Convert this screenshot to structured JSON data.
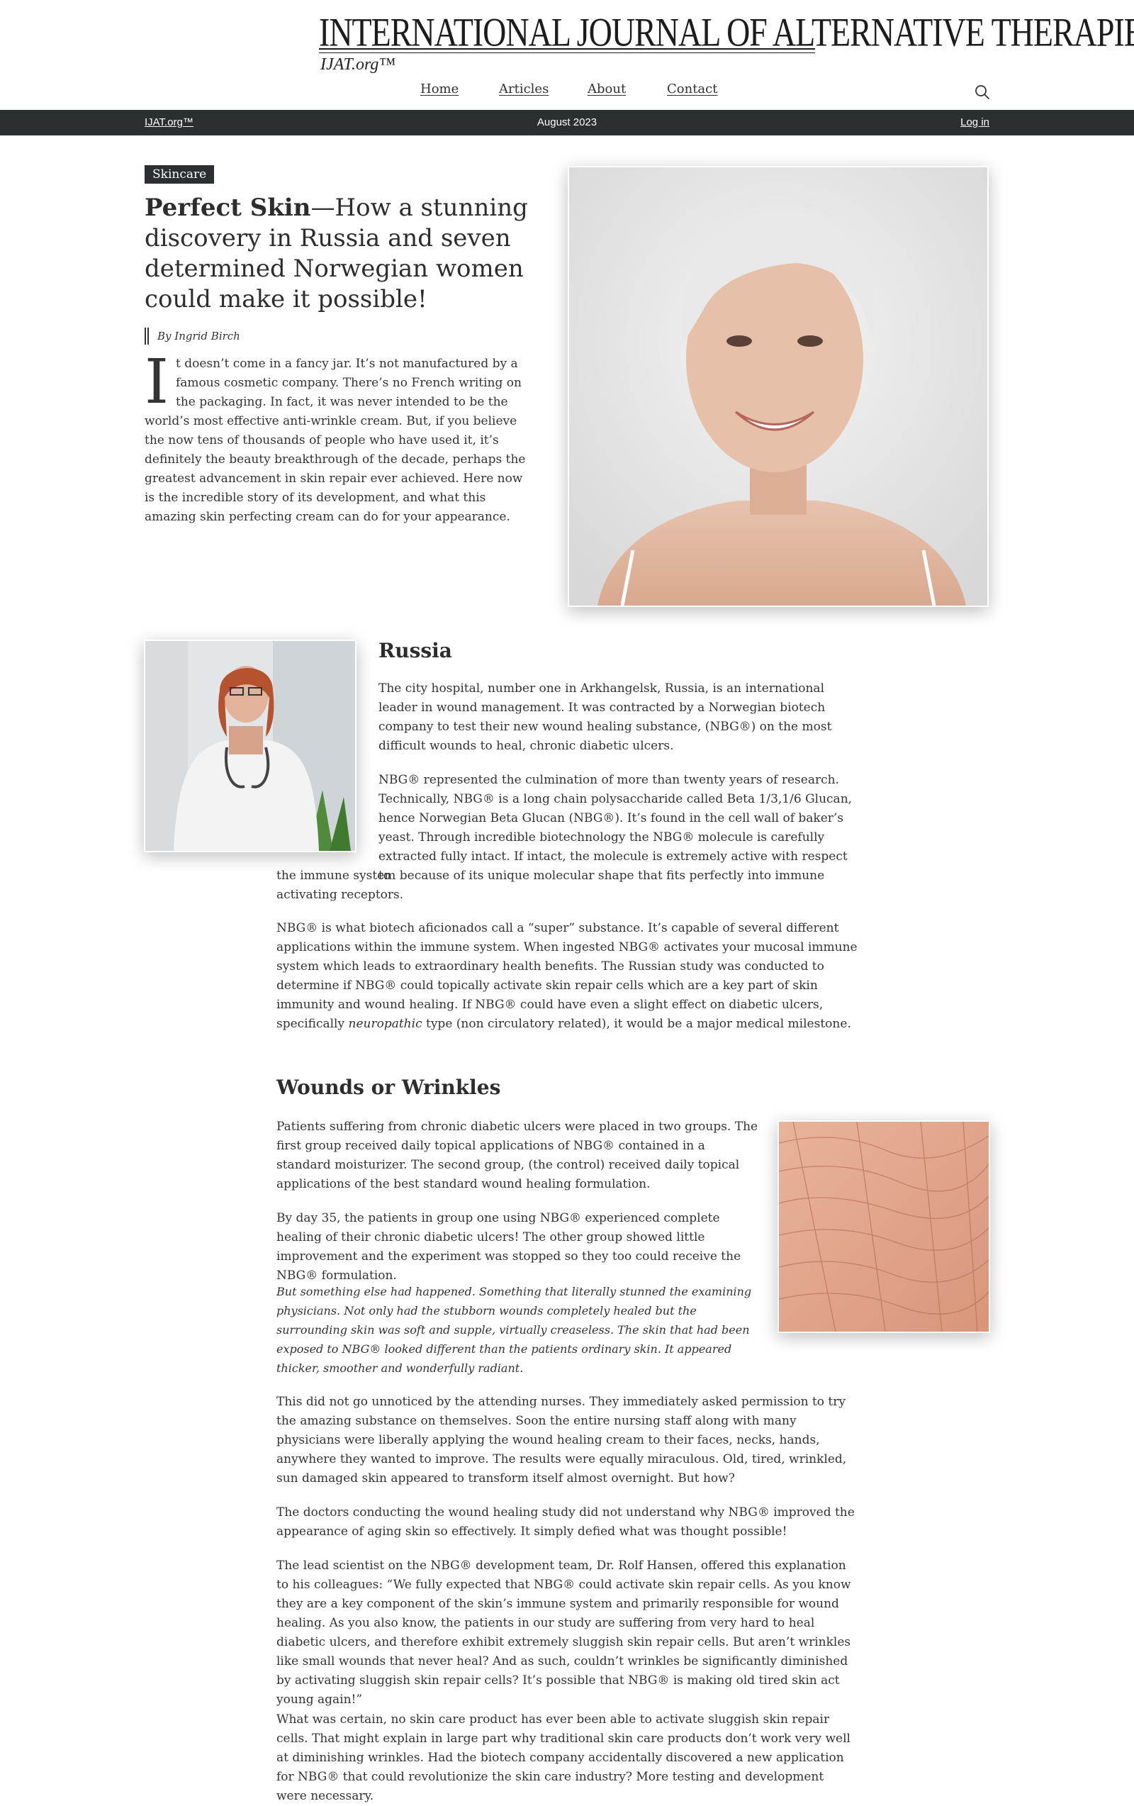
{
  "site": {
    "title": "International Journal of Alternative Therapies",
    "subtitle": "IJAT.org™"
  },
  "nav": {
    "items": [
      "Home",
      "Articles",
      "About",
      "Contact"
    ],
    "search_icon": "search-icon"
  },
  "topbar": {
    "left": "IJAT.org™",
    "date": "August 2023",
    "login": "Log in",
    "bg_color": "#2b2f30"
  },
  "article": {
    "category": "Skincare",
    "headline_bold": "Perfect Skin",
    "headline_rest": "—How a stunning discovery in Russia and seven determined Norwegian women could make it possible!",
    "byline": "By Ingrid Birch",
    "intro_dropcap": "I",
    "intro": "t doesn’t come in a fancy jar. It’s not manufactured by a famous cosmetic company. There’s no French writing on the packaging. In fact, it was never intended to be the world’s most effective anti-wrinkle cream. But, if you believe the now tens of thousands of people who have used it, it’s definitely the beauty breakthrough of the decade, perhaps the greatest advancement in skin repair ever achieved. Here now is the incredible story of its development, and what this amazing skin perfecting cream can do for your appearance."
  },
  "russia": {
    "heading": "Russia",
    "p1": "The city hospital, number one in Arkhangelsk, Russia, is an international leader in wound management. It was contracted by a Norwegian biotech company to test their new wound healing substance, (NBG®) on the most difficult wounds to heal, chronic diabetic ulcers.",
    "p2a": "NBG® represented the culmination of more than twenty years of research. Technically, NBG® is a long chain polysaccharide called Beta 1/3,1/6 Glucan, hence Norwegian Beta Glucan (NBG®). It’s found in the cell wall of baker’s yeast. Through incredible biotechnology the NBG® molecule is carefully extracted fully intact. If intact, the molecule is extremely active with respect to",
    "p2b": "the immune system because of its unique molecular shape that fits perfectly into immune activating receptors.",
    "p3": "NBG® is what biotech aficionados call a “super” substance. It’s capable of several different applications within the immune system. When ingested NBG® activates your mucosal immune system which leads to extraordinary health benefits. The Russian study was conducted to determine if NBG® could topically activate skin repair cells which are a key part of skin immunity and wound healing. If NBG® could have even a slight effect on diabetic ulcers, specifically",
    "p3_italic": "neuropathic",
    "p3_end": " type (non circulatory related), it would be a major medical milestone."
  },
  "wounds": {
    "heading": "Wounds or Wrinkles",
    "p1": "Patients suffering from chronic diabetic ulcers were placed in two groups. The first group received daily topical applications of NBG® contained in a standard moisturizer. The second group, (the control) received daily topical applications of the best standard wound healing formulation.",
    "p2": "By day 35, the patients in group one using NBG® experienced complete healing of their chronic diabetic ulcers! The other group showed little improvement and the experiment was stopped so they too could receive the NBG® formulation.",
    "p3": "But something else had happened. Something that literally stunned the examining physicians. Not only had the stubborn wounds completely healed but the surrounding skin was soft and supple, virtually creaseless. The skin that had been exposed to NBG® looked different than the patients ordinary skin. It appeared thicker, smoother and wonderfully radiant.",
    "p4": "This did not go unnoticed by the attending nurses. They immediately asked permission to try the amazing substance on themselves. Soon the entire nursing staff along with many physicians were liberally applying the wound healing cream to their faces, necks, hands, anywhere they wanted to improve. The results were equally miraculous. Old, tired, wrinkled, sun damaged skin appeared to transform itself almost overnight. But how?",
    "p5": "The doctors conducting the wound healing study did not understand why NBG® improved the appearance of aging skin so effectively. It simply defied what was thought possible!",
    "p6": "The lead scientist on the NBG® development team, Dr. Rolf Hansen, offered this explanation to his colleagues: “We fully expected that NBG® could activate skin repair cells. As you know they are a key component of the skin’s immune system and primarily responsible for wound healing. As you also know, the patients in our study are suffering from very hard to heal diabetic ulcers, and therefore exhibit extremely sluggish skin repair cells. But aren’t wrinkles like small wounds that never heal? And as such, couldn’t wrinkles be significantly diminished by activating sluggish skin repair cells? It’s possible that NBG® is making old tired skin act young again!”",
    "p7": "What was certain, no skin care product has ever been able to activate sluggish skin repair cells. That might explain in large part why traditional skin care products don’t work very well at diminishing wrinkles. Had the biotech company accidentally discovered a new application for NBG® that could revolutionize the skin care industry? More testing and development were necessary."
  }
}
